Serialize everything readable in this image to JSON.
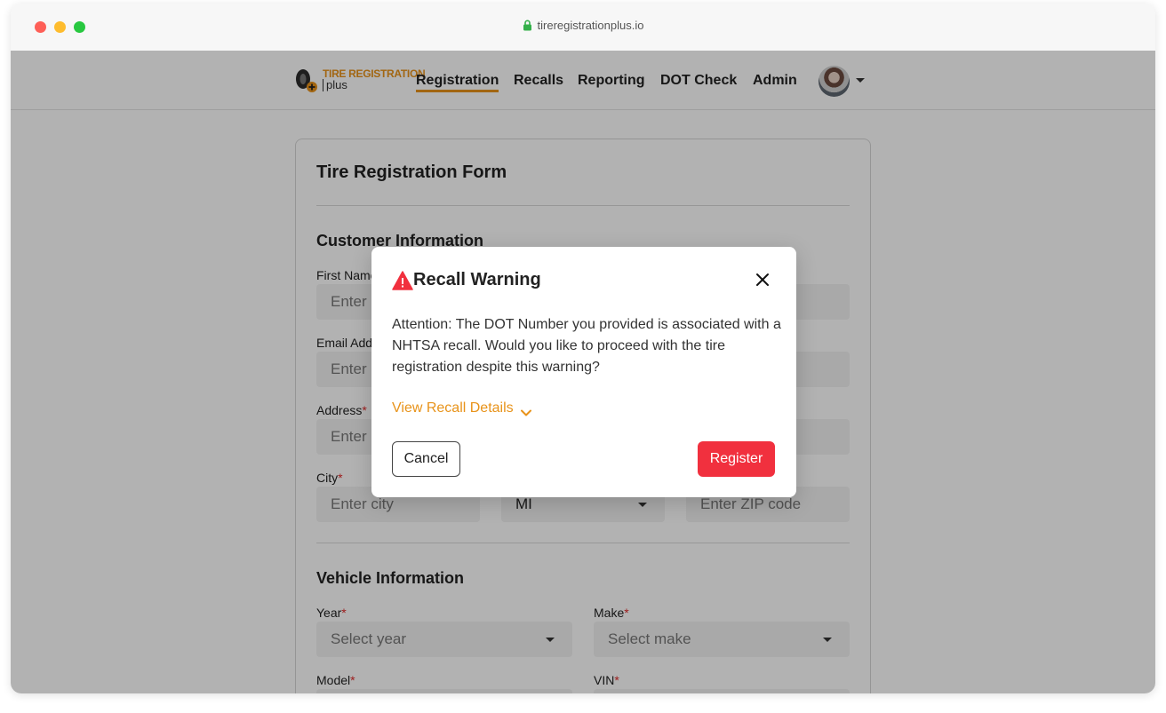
{
  "browser": {
    "url": "tireregistrationplus.io"
  },
  "logo": {
    "line1": "TIRE REGISTRATION",
    "line2": "plus"
  },
  "nav": {
    "items": [
      {
        "label": "Registration",
        "active": true
      },
      {
        "label": "Recalls"
      },
      {
        "label": "Reporting"
      },
      {
        "label": "DOT Check"
      },
      {
        "label": "Admin"
      }
    ]
  },
  "form": {
    "title": "Tire Registration Form",
    "customer": {
      "title": "Customer Information",
      "first_name_label": "First Name",
      "first_name_placeholder": "Enter",
      "email_label": "Email Address",
      "email_placeholder": "Enter",
      "address_label": "Address",
      "address_placeholder": "Enter",
      "city_label": "City",
      "city_placeholder": "Enter city",
      "state_value": "MI",
      "zip_placeholder": "Enter ZIP code"
    },
    "vehicle": {
      "title": "Vehicle Information",
      "year_label": "Year",
      "year_placeholder": "Select year",
      "make_label": "Make",
      "make_placeholder": "Select make",
      "model_label": "Model",
      "vin_label": "VIN"
    },
    "required_mark": "*"
  },
  "modal": {
    "title": "Recall Warning",
    "body": "Attention: The DOT Number you provided is associated with a NHTSA recall. Would you like to proceed with the tire registration despite this warning?",
    "details_link": "View Recall Details",
    "cancel_label": "Cancel",
    "register_label": "Register"
  },
  "colors": {
    "accent": "#e8931a",
    "danger": "#f1303e",
    "required": "#e02b2b"
  }
}
